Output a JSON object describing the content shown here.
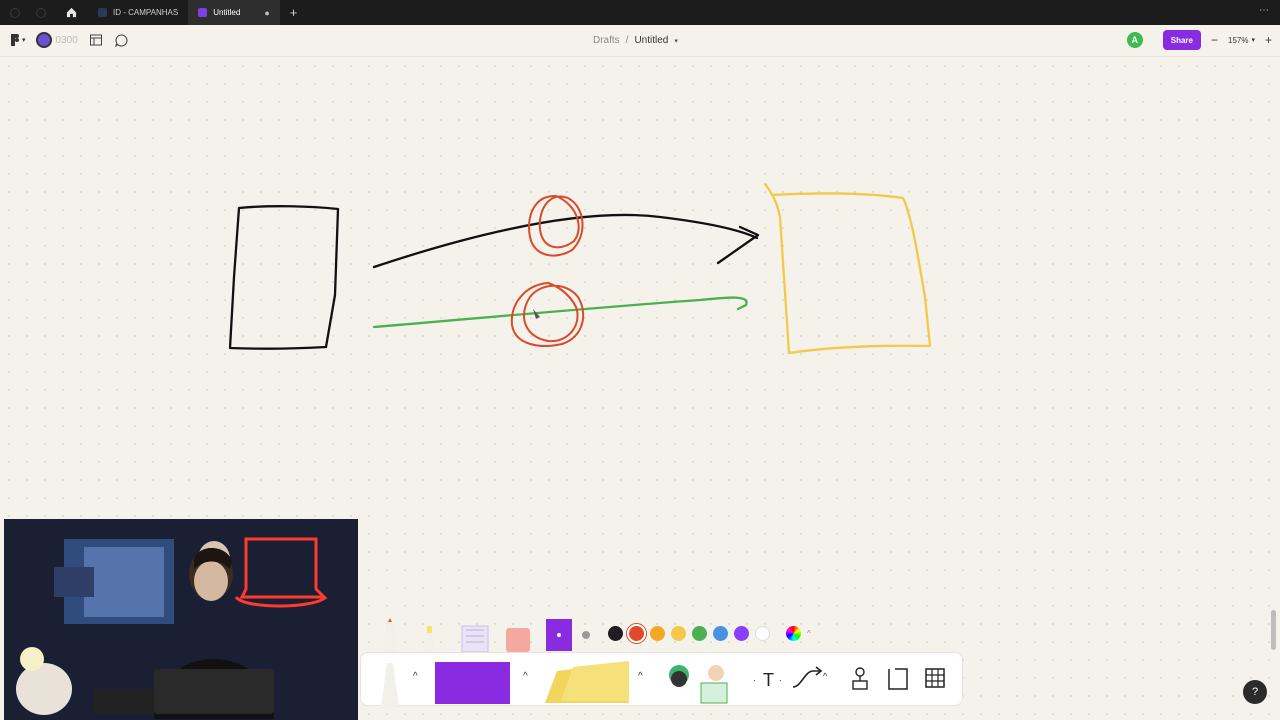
{
  "tabs": [
    {
      "label": "ID - CAMPANHAS",
      "active": false
    },
    {
      "label": "Untitled",
      "active": true
    }
  ],
  "appbar": {
    "avatar_label": "0300",
    "breadcrumb_parent": "Drafts",
    "breadcrumb_separator": "/",
    "file_name": "Untitled",
    "user_initial": "A",
    "share_label": "Share",
    "zoom_level": "157%",
    "zoom_out": "−",
    "zoom_in": "+"
  },
  "colors": {
    "accent": "#8a2be2",
    "user_badge": "#3fb950",
    "swatches": [
      "#1e1e1e",
      "#e04a2a",
      "#f5a623",
      "#f2c94c",
      "#4caf50",
      "#4a90e2",
      "#8a3ffc",
      "#ffffff"
    ],
    "selected_swatch": "#e04a2a"
  },
  "tools": {
    "text_tool": "T",
    "help": "?"
  },
  "icons": [
    "figma-logo-icon",
    "layout-icon",
    "comment-icon",
    "home-icon",
    "close-icon",
    "plus-icon",
    "more-icon",
    "chevron-down-icon",
    "pencil-icon",
    "highlighter-icon",
    "wash-tape-icon",
    "eraser-icon",
    "color-wheel-icon",
    "sticky-note-icon",
    "stamp-icon",
    "connector-icon",
    "section-icon",
    "table-icon"
  ]
}
